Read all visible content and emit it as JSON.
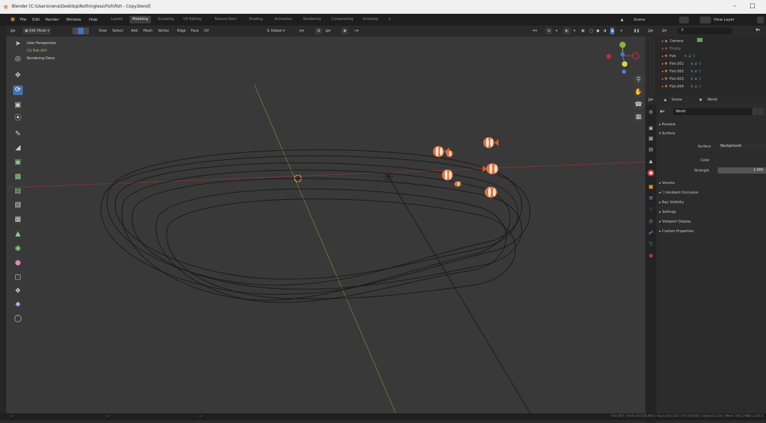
{
  "window": {
    "title": "Blender [C:\\Users\\nena\\Desktop\\Nothingless\\Fish\\fish - Copy.blend]",
    "minimize": "–",
    "maximize": "□"
  },
  "menubar": {
    "items": [
      "File",
      "Edit",
      "Render",
      "Window",
      "Help"
    ],
    "workspaces": [
      "Layout",
      "Modeling",
      "Sculpting",
      "UV Editing",
      "Texture Paint",
      "Shading",
      "Animation",
      "Rendering",
      "Compositing",
      "Scripting",
      "+"
    ],
    "active_workspace": "Modeling",
    "scene": "Scene",
    "view_layer": "View Layer"
  },
  "viewport_header": {
    "mode": "Edit Mode",
    "menus": [
      "View",
      "Select",
      "Add",
      "Mesh",
      "Vertex",
      "Edge",
      "Face",
      "UV"
    ],
    "orientation": "Global"
  },
  "viewport": {
    "view_name": "User Perspective",
    "object_name": "(1) Fish.007",
    "status": "Rendering Done",
    "gizmo": {
      "x": "X",
      "y": "Y",
      "z": "Z"
    }
  },
  "outliner": {
    "search_placeholder": "",
    "items": [
      {
        "icon": "camera-icon",
        "label": "Camera"
      },
      {
        "icon": "empty-icon",
        "label": "Empty"
      },
      {
        "icon": "mesh-icon",
        "label": "Fish"
      },
      {
        "icon": "mesh-icon",
        "label": "Fish.001"
      },
      {
        "icon": "mesh-icon",
        "label": "Fish.002"
      },
      {
        "icon": "mesh-icon",
        "label": "Fish.003"
      },
      {
        "icon": "mesh-icon",
        "label": "Fish.004"
      }
    ]
  },
  "properties": {
    "breadcrumb_scene": "Scene",
    "breadcrumb_world": "World",
    "world_name": "World",
    "sections": {
      "preview": "Preview",
      "surface": "Surface",
      "volume": "Volume",
      "ambient_occlusion": "Ambient Occlusion",
      "ray_visibility": "Ray Visibility",
      "settings": "Settings",
      "viewport_display": "Viewport Display",
      "custom_properties": "Custom Properties"
    },
    "surface_label": "Surface",
    "surface_value": "Background",
    "color_label": "Color",
    "strength_label": "Strength",
    "strength_value": "1.000"
  },
  "statusbar": {
    "stats": "Fish.007 | Verts 0/1316,940 | Faces 0/0,130 | Tris 0/0,940 | Objects 1/16 | Mem: 194.2 MiB | 2.92.0"
  },
  "colors": {
    "accent": "#4772b3",
    "x_axis": "#c0303c",
    "y_axis": "#8fb33a",
    "fish_orange": "#e0733a"
  }
}
